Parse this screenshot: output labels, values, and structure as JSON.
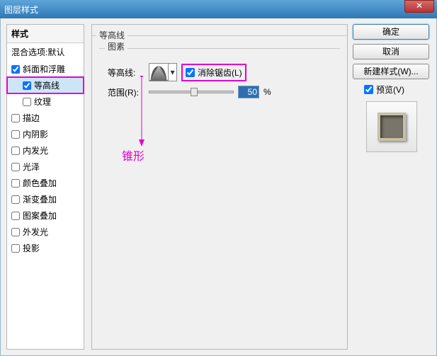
{
  "window": {
    "title": "图层样式"
  },
  "left": {
    "header": "样式",
    "blend": "混合选项:默认",
    "items": [
      {
        "label": "斜面和浮雕",
        "checked": true
      },
      {
        "label": "等高线",
        "checked": true,
        "selected": true,
        "magenta": true,
        "indent": true
      },
      {
        "label": "纹理",
        "checked": false,
        "indent": true
      },
      {
        "label": "描边",
        "checked": false
      },
      {
        "label": "内阴影",
        "checked": false
      },
      {
        "label": "内发光",
        "checked": false
      },
      {
        "label": "光泽",
        "checked": false
      },
      {
        "label": "颜色叠加",
        "checked": false
      },
      {
        "label": "渐变叠加",
        "checked": false
      },
      {
        "label": "图案叠加",
        "checked": false
      },
      {
        "label": "外发光",
        "checked": false
      },
      {
        "label": "投影",
        "checked": false
      }
    ]
  },
  "center": {
    "group_title": "等高线",
    "inner_title": "图素",
    "contour_label": "等高线:",
    "antialias_label": "消除锯齿(L)",
    "antialias_checked": true,
    "range_label": "范围(R):",
    "range_value": "50",
    "range_unit": "%",
    "annotation": "锥形"
  },
  "right": {
    "ok": "确定",
    "cancel": "取消",
    "new_style": "新建样式(W)...",
    "preview_label": "预览(V)",
    "preview_checked": true
  }
}
